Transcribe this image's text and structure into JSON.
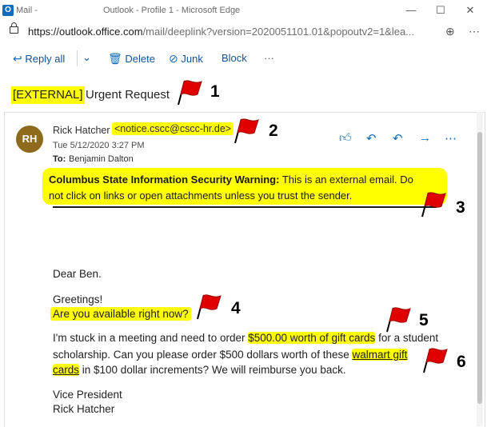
{
  "browser": {
    "app_name": "Mail -",
    "window_title": "Outlook - Profile 1 - Microsoft Edge",
    "url_host": "https://outlook.office.com",
    "url_path": "/mail/deeplink?version=2020051101.01&popoutv2=1&lea..."
  },
  "toolbar": {
    "reply_all": "Reply all",
    "delete": "Delete",
    "junk": "Junk",
    "block": "Block",
    "more": "···"
  },
  "email": {
    "subject_tag": "[EXTERNAL]",
    "subject": "Urgent Request",
    "avatar_initials": "RH",
    "sender_name": "Rick Hatcher",
    "sender_email": "<notice.cscc@cscc-hr.de>",
    "date": "Tue 5/12/2020 3:27 PM",
    "to_label": "To:",
    "to_value": "Benjamin Dalton",
    "warning_bold": "Columbus State Information Security Warning:",
    "warning_text_1": " This is an external email. Do",
    "warning_text_2": "not click on links or open attachments unless you trust the sender.",
    "greeting": "Dear Ben.",
    "line_greetings": "Greetings!",
    "line_available": "Are you available right now?",
    "body_1a": "I'm stuck in a meeting and need to order ",
    "body_1_hl": "$500.00 worth of gift cards",
    "body_1b": " for a student",
    "body_2a": "scholarship.  Can you please order $500 dollars worth of these ",
    "body_2_hl": "walmart gift",
    "body_3_hl": "cards",
    "body_3b": " in $100 dollar increments? We will reimburse you back.",
    "sig_title": "Vice President",
    "sig_name": "Rick Hatcher"
  },
  "markers": [
    "1",
    "2",
    "3",
    "4",
    "5",
    "6"
  ],
  "colors": {
    "highlight": "#ffff00",
    "flag": "#e00000",
    "accent": "#0f6cbd"
  }
}
